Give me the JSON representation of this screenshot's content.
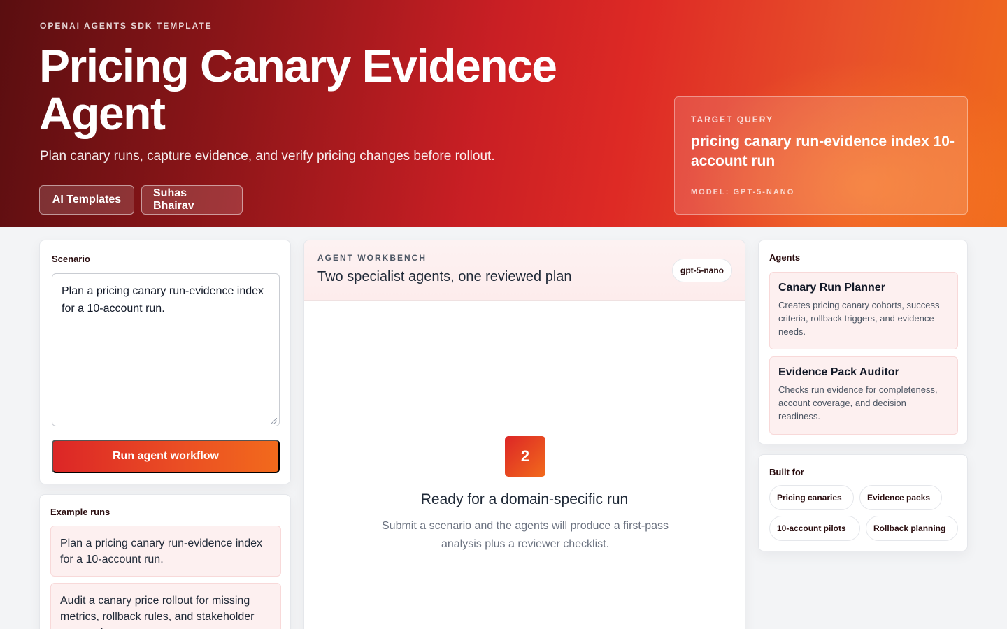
{
  "hero": {
    "eyebrow": "OPENAI AGENTS SDK TEMPLATE",
    "title": "Pricing Canary Evidence Agent",
    "subtitle": "Plan canary runs, capture evidence, and verify pricing changes before rollout.",
    "buttons": [
      "AI Templates",
      "Suhas Bhairav"
    ]
  },
  "target": {
    "label": "TARGET QUERY",
    "query": "pricing canary run-evidence index 10-account run",
    "model": "MODEL: GPT-5-NANO"
  },
  "scenario": {
    "title": "Scenario",
    "value": "Plan a pricing canary run-evidence index for a 10-account run.",
    "run_label": "Run agent workflow"
  },
  "examples": {
    "title": "Example runs",
    "items": [
      "Plan a pricing canary run-evidence index for a 10-account run.",
      "Audit a canary price rollout for missing metrics, rollback rules, and stakeholder approvals."
    ]
  },
  "workbench": {
    "label": "AGENT WORKBENCH",
    "title": "Two specialist agents, one reviewed plan",
    "model_pill": "gpt-5-nano",
    "count": "2",
    "ready_title": "Ready for a domain-specific run",
    "ready_desc": "Submit a scenario and the agents will produce a first-pass analysis plus a reviewer checklist."
  },
  "agents": {
    "title": "Agents",
    "items": [
      {
        "name": "Canary Run Planner",
        "desc": "Creates pricing canary cohorts, success criteria, rollback triggers, and evidence needs."
      },
      {
        "name": "Evidence Pack Auditor",
        "desc": "Checks run evidence for completeness, account coverage, and decision readiness."
      }
    ]
  },
  "built_for": {
    "title": "Built for",
    "chips": [
      "Pricing canaries",
      "Evidence packs",
      "10-account pilots",
      "Rollback planning"
    ]
  },
  "colors": {
    "accent": "#dc2626",
    "accent_end": "#f26a1c",
    "hero_dark": "#5a0e10",
    "card_tint": "#fdf0f0"
  }
}
